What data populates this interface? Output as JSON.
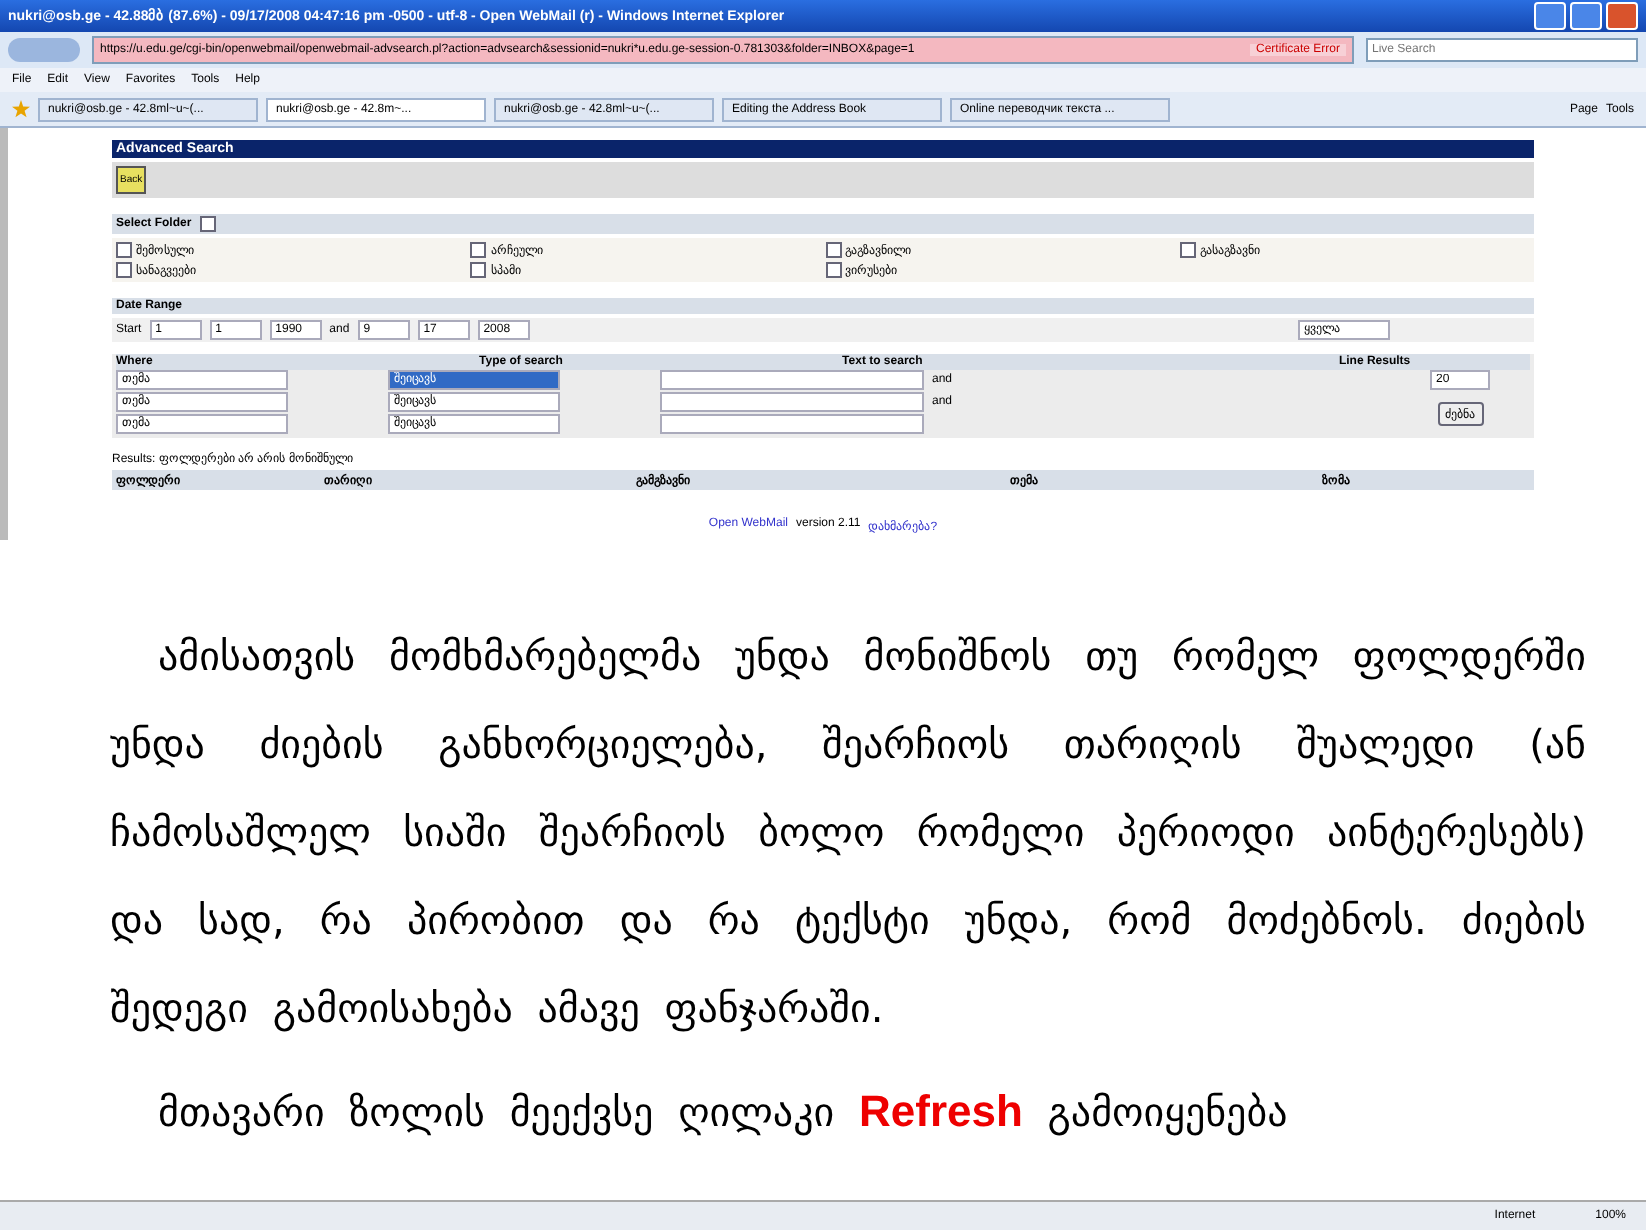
{
  "window": {
    "title": "nukri@osb.ge - 42.88მბ (87.6%) - 09/17/2008 04:47:16 pm -0500 - utf-8 - Open WebMail (r) - Windows Internet Explorer",
    "address": "https://u.edu.ge/cgi-bin/openwebmail/openwebmail-advsearch.pl?action=advsearch&sessionid=nukri*u.edu.ge-session-0.781303&folder=INBOX&page=1",
    "certificate": "Certificate Error",
    "search_placeholder": "Live Search"
  },
  "menu": [
    "File",
    "Edit",
    "View",
    "Favorites",
    "Tools",
    "Help"
  ],
  "tabs": [
    {
      "label": "nukri@osb.ge - 42.8ml~u~(...",
      "selected": false
    },
    {
      "label": "nukri@osb.ge - 42.8m~...",
      "selected": true
    },
    {
      "label": "nukri@osb.ge - 42.8ml~u~(...",
      "selected": false
    },
    {
      "label": "Editing the Address Book",
      "selected": false
    },
    {
      "label": "Online переводчик текста ...",
      "selected": false
    }
  ],
  "toolbar_right": [
    "Page",
    "Tools"
  ],
  "page": {
    "heading": "Advanced Search",
    "back": "Back",
    "folder_label": "Select Folder",
    "select_all_checked": false,
    "folders": [
      {
        "label": "შემოსული",
        "checked": false
      },
      {
        "label": "არჩეული",
        "checked": false
      },
      {
        "label": "გაგზავნილი",
        "checked": false
      },
      {
        "label": "გასაგზავნი",
        "checked": false
      },
      {
        "label": "სანაგვეები",
        "checked": false
      },
      {
        "label": "სპამი",
        "checked": false
      },
      {
        "label": "ვირუსები",
        "checked": false
      }
    ],
    "date_label": "Date Range",
    "start": "Start",
    "start_values": [
      "1",
      "1",
      "1990"
    ],
    "and": "and",
    "end_values": [
      "9",
      "17",
      "2008"
    ],
    "period": "ყველა",
    "where_header": "Where",
    "type_header": "Type of search",
    "text_header": "Text to search",
    "line_header": "Line Results",
    "rows": [
      {
        "where": "თემა",
        "type": "შეიცავს",
        "type_selected": true,
        "connector": "and"
      },
      {
        "where": "თემა",
        "type": "შეიცავს",
        "type_selected": false,
        "connector": "and"
      },
      {
        "where": "თემა",
        "type": "შეიცავს",
        "type_selected": false
      }
    ],
    "line_value": "20",
    "search_button": "ძებნა",
    "results": "Results: ფოლდერები არ არის მონიშნული",
    "result_columns": [
      "ფოლდერი",
      "თარიღი",
      "გამგზავნი",
      "თემა",
      "ზომა"
    ],
    "footer_link": "Open WebMail",
    "footer_version": "version 2.11",
    "footer_help": "დახმარება?"
  },
  "document": {
    "paragraph": "ამისათვის მომხმარებელმა უნდა მონიშნოს თუ რომელ ფოლდერში უნდა ძიების განხორციელება, შეარჩიოს თარიღის შუალედი (ან ჩამოსაშლელ სიაში შეარჩიოს ბოლო რომელი პერიოდი აინტერესებს) და სად, რა პირობით და რა ტექსტი უნდა, რომ მოძებნოს. ძიების შედეგი გამოისახება ამავე ფანჯარაში.",
    "last_before": "მთავარი ზოლის მეექვსე ღილაკი",
    "last_highlight": "Refresh",
    "last_after": "გამოიყენება"
  },
  "status_bar": {
    "zone": "Internet",
    "zoom": "100%"
  }
}
